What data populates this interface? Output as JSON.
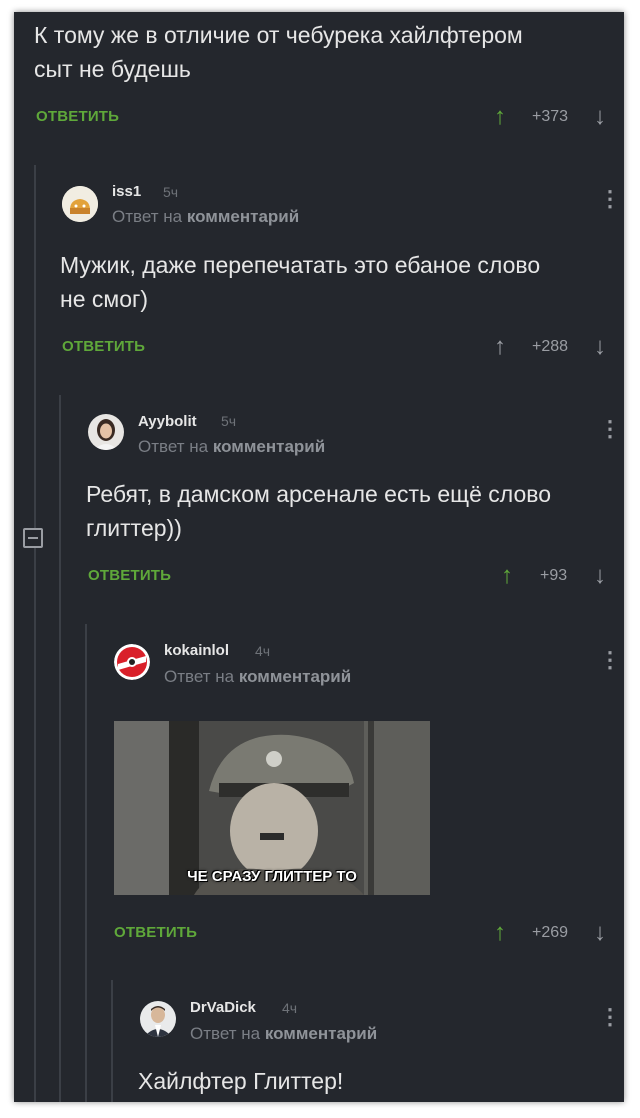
{
  "top_comment": {
    "text_line1": "К тому же в отличие от чебурека хайлфтером",
    "text_line2": "сыт не будешь",
    "reply_label": "ОТВЕТИТЬ",
    "score": "+373"
  },
  "comments": [
    {
      "username": "iss1",
      "time": "5ч",
      "subtitle_prefix": "Ответ на",
      "subtitle_link": "комментарий",
      "text_line1": "Мужик, даже перепечатать это ебаное слово",
      "text_line2": "не смог)",
      "reply_label": "ОТВЕТИТЬ",
      "score": "+288"
    },
    {
      "username": "Ayybolit",
      "time": "5ч",
      "subtitle_prefix": "Ответ на",
      "subtitle_link": "комментарий",
      "text_line1": "Ребят, в дамском арсенале есть ещё слово",
      "text_line2": "глиттер))",
      "reply_label": "ОТВЕТИТЬ",
      "score": "+93"
    },
    {
      "username": "kokainlol",
      "time": "4ч",
      "subtitle_prefix": "Ответ на",
      "subtitle_link": "комментарий",
      "image_caption": "ЧЕ СРАЗУ ГЛИТТЕР ТО",
      "reply_label": "ОТВЕТИТЬ",
      "score": "+269"
    },
    {
      "username": "DrVaDick",
      "time": "4ч",
      "subtitle_prefix": "Ответ на",
      "subtitle_link": "комментарий",
      "text_line1": "Хайлфтер Глиттер!"
    }
  ],
  "icons": {
    "upvote": "arrow-up-icon",
    "downvote": "arrow-down-icon",
    "menu": "kebab-menu-icon",
    "collapse": "collapse-thread-icon"
  },
  "colors": {
    "background": "#24272d",
    "accent_green": "#5fa83a",
    "text": "#e6e6e6",
    "muted": "#7a7e85"
  }
}
